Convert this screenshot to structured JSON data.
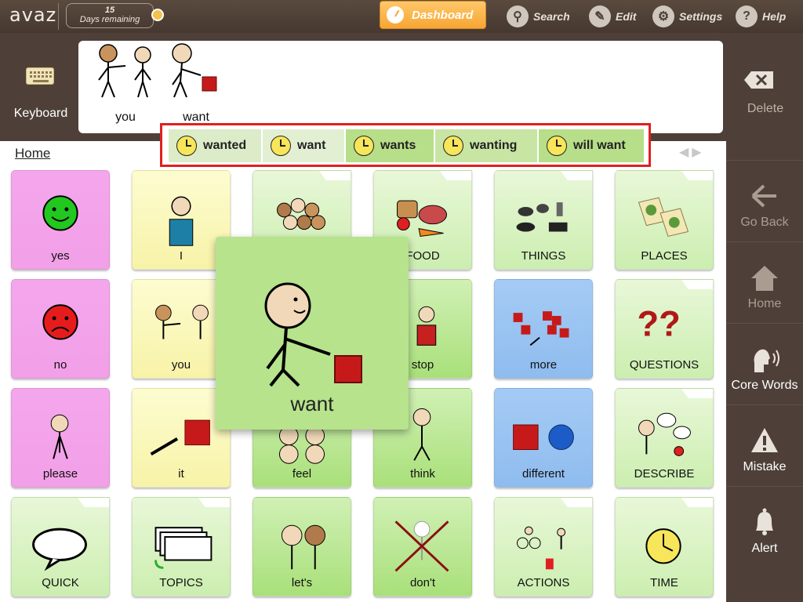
{
  "topbar": {
    "logo": "avaz",
    "days_number": "15",
    "days_label": "Days remaining",
    "dashboard": "Dashboard",
    "search": "Search",
    "edit": "Edit",
    "settings": "Settings",
    "help": "Help"
  },
  "message_bar": {
    "keyboard": "Keyboard",
    "delete": "Delete",
    "words": [
      "you",
      "want"
    ]
  },
  "grammar": {
    "forms": [
      "wanted",
      "want",
      "wants",
      "wanting",
      "will want"
    ]
  },
  "breadcrumb": "Home",
  "tiles": {
    "r1": [
      "yes",
      "I",
      "",
      "FOOD",
      "THINGS",
      "PLACES"
    ],
    "r2": [
      "no",
      "you",
      "",
      "stop",
      "more",
      "QUESTIONS"
    ],
    "r3": [
      "please",
      "it",
      "feel",
      "think",
      "different",
      "DESCRIBE"
    ],
    "r4": [
      "QUICK",
      "TOPICS",
      "let's",
      "don't",
      "ACTIONS",
      "TIME"
    ]
  },
  "popup": {
    "label": "want"
  },
  "sidebar": {
    "go_back": "Go Back",
    "home": "Home",
    "core_words": "Core Words",
    "mistake": "Mistake",
    "alert": "Alert"
  },
  "colors": {
    "topbar": "#4e4038",
    "dashboard": "#f7a533",
    "pink_tile": "#f2a0e8",
    "yellow_tile": "#f7f3a8",
    "green_tile": "#cceeb0",
    "blue_tile": "#8fbcef",
    "highlight_border": "#e02020"
  }
}
